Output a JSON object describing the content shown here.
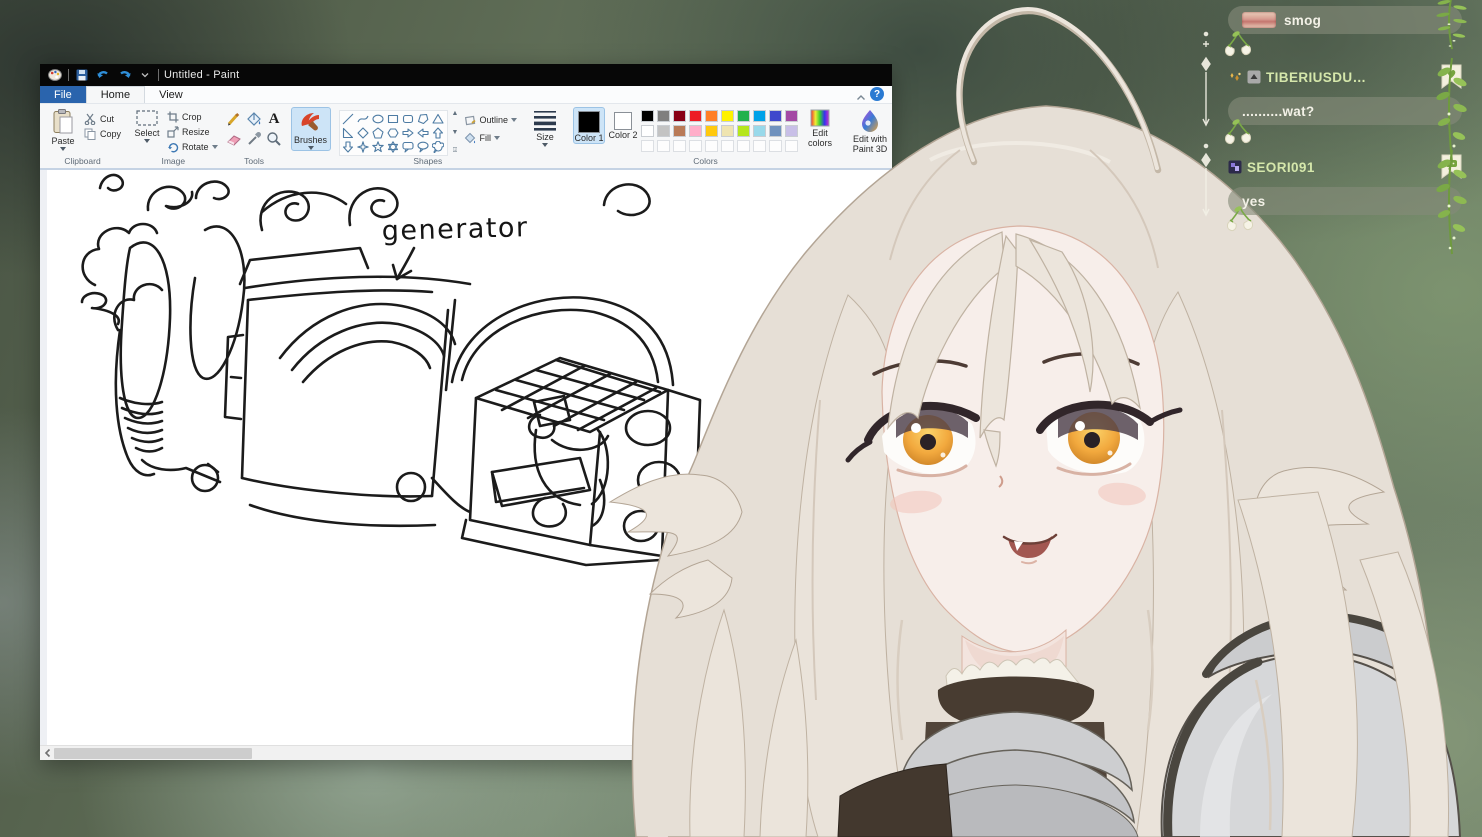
{
  "theme": {
    "file_tab_blue": "#2a64ad",
    "selected_tool_bg": "#cde4f7",
    "username_green": "#d5e7ab",
    "chat_text": "#f3f1e7",
    "bubble_bg": "rgba(133,138,121,0.62)",
    "vine_green": "#82b04a",
    "color1_value": "#000000",
    "color2_value": "#ffffff"
  },
  "paint": {
    "window_title": "Untitled - Paint",
    "titlebar_icons": [
      "paint-logo",
      "save",
      "undo",
      "redo",
      "toolbar-dropdown"
    ],
    "help_glyph": "?",
    "tabs": {
      "file": "File",
      "home": "Home",
      "view": "View"
    },
    "ribbon": {
      "clipboard": {
        "group_label": "Clipboard",
        "paste": "Paste",
        "cut": "Cut",
        "copy": "Copy"
      },
      "image": {
        "group_label": "Image",
        "select": "Select",
        "crop": "Crop",
        "resize": "Resize",
        "rotate": "Rotate"
      },
      "tools": {
        "group_label": "Tools",
        "text_tool_glyph": "A"
      },
      "brushes_label": "Brushes",
      "shapes": {
        "group_label": "Shapes",
        "outline": "Outline",
        "fill": "Fill",
        "items": [
          "line",
          "curve",
          "ellipse",
          "rectangle",
          "rounded-rectangle",
          "polygon",
          "triangle",
          "right-triangle",
          "diamond",
          "pentagon",
          "hexagon",
          "arrow-right",
          "arrow-left",
          "arrow-up",
          "arrow-down",
          "star-4",
          "star-5",
          "star-6",
          "callout-rounded",
          "callout-oval",
          "callout-cloud"
        ]
      },
      "size_label": "Size",
      "colors": {
        "group_label": "Colors",
        "color1_label": "Color 1",
        "color2_label": "Color 2",
        "edit_colors_label": "Edit colors",
        "palette": [
          [
            "#000000",
            "#7f7f7f",
            "#880015",
            "#ed1c24",
            "#ff7f27",
            "#fff200",
            "#22b14c",
            "#00a2e8",
            "#3f48cc",
            "#a349a4"
          ],
          [
            "#ffffff",
            "#c3c3c3",
            "#b97a57",
            "#ffaec9",
            "#ffc90e",
            "#efe4b0",
            "#b5e61d",
            "#99d9ea",
            "#7092be",
            "#c8bfe7"
          ],
          [
            null,
            null,
            null,
            null,
            null,
            null,
            null,
            null,
            null,
            null
          ]
        ]
      },
      "paint3d_label": "Edit with Paint 3D"
    },
    "canvas_annotation": "generator"
  },
  "chat": {
    "messages": [
      {
        "emote": "pink-smudge-emote",
        "text": "smog"
      },
      {
        "username": "TIBERIUSDU…",
        "badges": [
          "gold-sparkle-badge",
          "gray-arrow-badge"
        ],
        "bookmark": "heart-bookmark",
        "text": "..........wat?"
      },
      {
        "username": "SEORI091",
        "badges": [
          "purple-subscriber-badge"
        ],
        "bookmark": "chat-bookmark",
        "text": "yes"
      }
    ]
  }
}
